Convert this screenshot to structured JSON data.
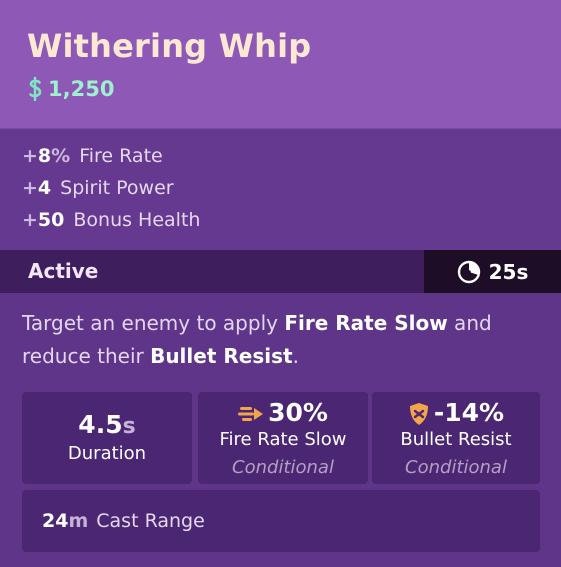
{
  "item": {
    "title": "Withering Whip",
    "cost": "1,250",
    "cost_icon": "souls-currency-icon"
  },
  "stats": [
    {
      "sign": "+",
      "value": "8",
      "unit": "%",
      "label": "Fire Rate"
    },
    {
      "sign": "+",
      "value": "4",
      "unit": "",
      "label": "Spirit Power"
    },
    {
      "sign": "+",
      "value": "50",
      "unit": "",
      "label": "Bonus Health"
    }
  ],
  "active": {
    "label": "Active",
    "cooldown": "25s",
    "cooldown_icon": "cooldown-timer-icon"
  },
  "description": {
    "part1": "Target an enemy to apply ",
    "bold1": "Fire Rate Slow",
    "part2": " and reduce their ",
    "bold2": "Bullet Resist",
    "part3": "."
  },
  "effects": {
    "duration": {
      "value": "4.5",
      "unit": "s",
      "label": "Duration"
    },
    "fire_rate_slow": {
      "value": "30%",
      "label": "Fire Rate Slow",
      "note": "Conditional",
      "icon": "fire-rate-icon"
    },
    "bullet_resist": {
      "value": "-14%",
      "label": "Bullet Resist",
      "note": "Conditional",
      "icon": "bullet-resist-shield-icon"
    },
    "cast_range": {
      "value": "24",
      "unit": "m",
      "label": "Cast Range"
    }
  },
  "colors": {
    "header_bg": "#8e58b6",
    "body_bg": "#5e3589",
    "title": "#fde8d3",
    "cost": "#9ff0ce",
    "icon_orange": "#f2a54a"
  }
}
